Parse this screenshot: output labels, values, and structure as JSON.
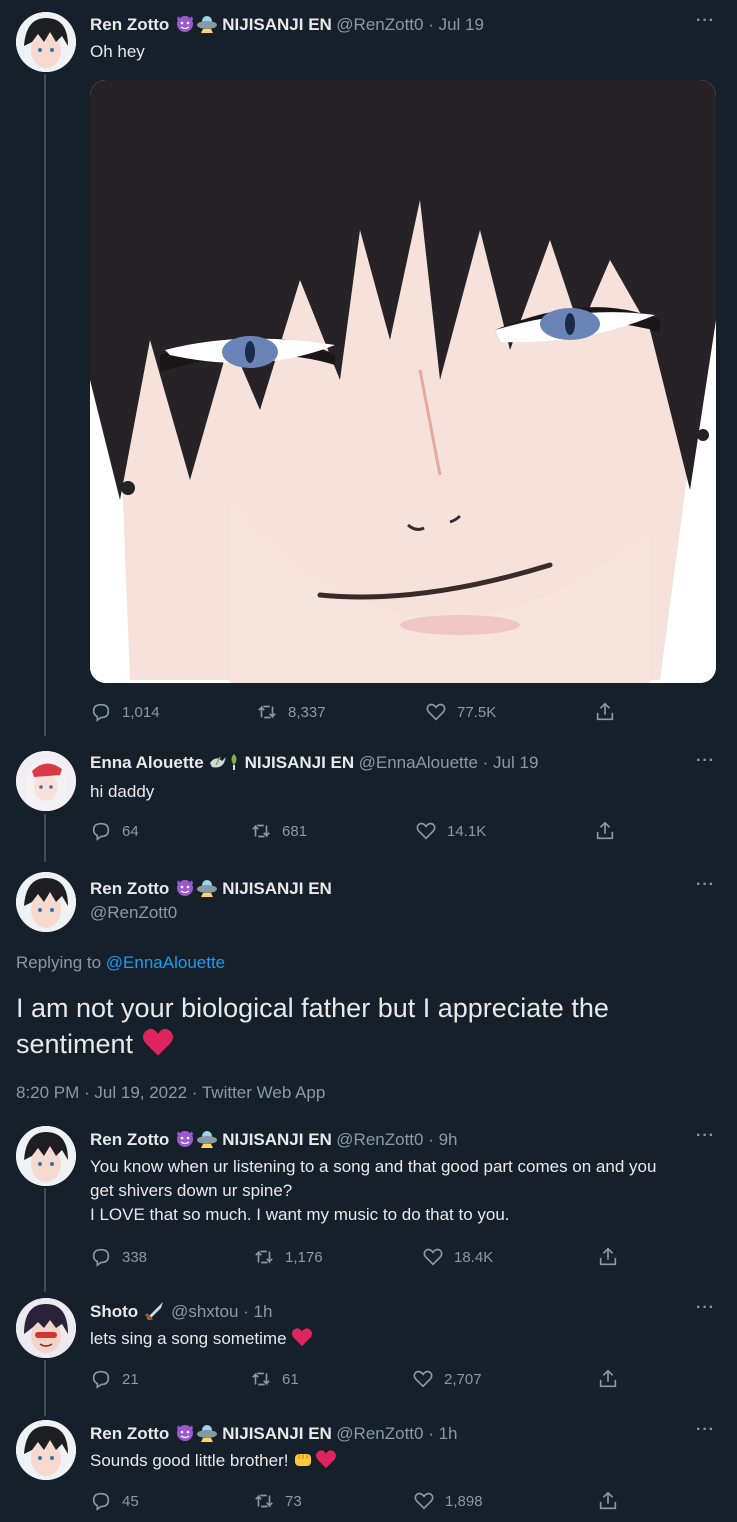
{
  "tweets": [
    {
      "name": "Ren Zotto",
      "badge": "NIJISANJI EN",
      "handle": "@RenZott0 · Jul 19",
      "text": "Oh hey",
      "replies": "1,014",
      "retweets": "8,337",
      "likes": "77.5K"
    },
    {
      "name": "Enna Alouette",
      "badge": "NIJISANJI EN",
      "handle": "@EnnaAlouette · Jul 19",
      "text": "hi daddy",
      "replies": "64",
      "retweets": "681",
      "likes": "14.1K"
    },
    {
      "name": "Ren Zotto",
      "badge": "NIJISANJI EN",
      "handle": "@RenZott0 · 9h",
      "text_line1": "You know when ur listening to a song and that good part comes on and you",
      "text_line2": "get shivers down ur spine?",
      "text_line3": "I LOVE that so much. I want my music to do that to you.",
      "replies": "338",
      "retweets": "1,176",
      "likes": "18.4K"
    },
    {
      "name": "Shoto",
      "handle": "@shxtou · 1h",
      "text": "lets sing a song sometime",
      "replies": "21",
      "retweets": "61",
      "likes": "2,707"
    },
    {
      "name": "Ren Zotto",
      "badge": "NIJISANJI EN",
      "handle": "@RenZott0 · 1h",
      "text": "Sounds good little brother!",
      "replies": "45",
      "retweets": "73",
      "likes": "1,898"
    }
  ],
  "focused": {
    "name": "Ren Zotto",
    "badge": "NIJISANJI EN",
    "handle": "@RenZott0",
    "replying_prefix": "Replying to",
    "replying_to": "@EnnaAlouette",
    "text_line1": "I am not your biological father but I appreciate the",
    "text_line2": "sentiment",
    "meta": "8:20 PM · Jul 19, 2022 · Twitter Web App"
  },
  "more_label": "···",
  "icons": [
    "reply-icon",
    "retweet-icon",
    "like-icon",
    "share-icon",
    "more-icon"
  ],
  "colors": {
    "background": "#15202b",
    "link": "#1d9bf0",
    "muted": "#8b98a5",
    "heart": "#e0245e"
  }
}
